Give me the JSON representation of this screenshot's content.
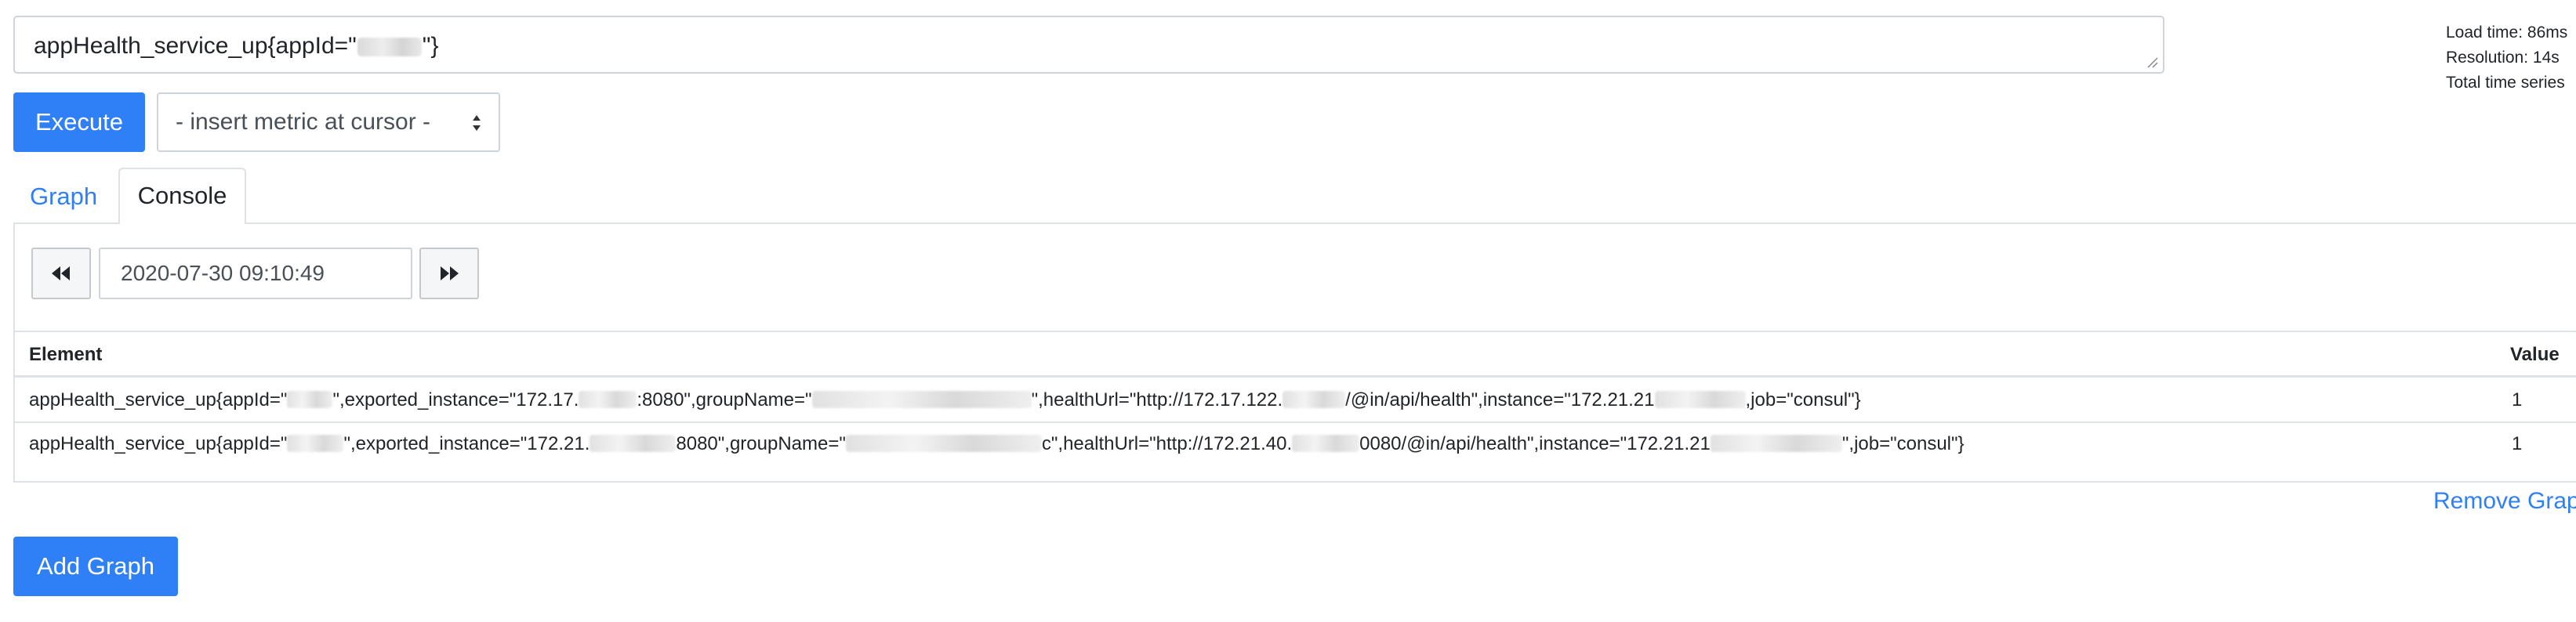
{
  "query": {
    "prefix": "appHealth_service_up{appId=\"",
    "suffix": "\"}"
  },
  "stats": {
    "load_time": "Load time: 86ms",
    "resolution": "Resolution: 14s",
    "total_series": "Total time series"
  },
  "toolbar": {
    "execute_label": "Execute",
    "metric_select_value": "- insert metric at cursor -"
  },
  "tabs": {
    "graph": "Graph",
    "console": "Console",
    "active": "Console"
  },
  "console": {
    "eval_time": "2020-07-30 09:10:49"
  },
  "table": {
    "headers": {
      "element": "Element",
      "value": "Value"
    },
    "rows": [
      {
        "parts": [
          "appHealth_service_up{appId=\"",
          "\",exported_instance=\"172.17.",
          ":8080\",groupName=\"",
          "\",healthUrl=\"http://172.17.122.",
          "/@in/api/health\",instance=\"172.21.21",
          ",job=\"consul\"}"
        ],
        "value": "1"
      },
      {
        "parts": [
          "appHealth_service_up{appId=\"",
          "\",exported_instance=\"172.21.",
          "8080\",groupName=\"",
          "c\",healthUrl=\"http://172.21.40.",
          "0080/@in/api/health\",instance=\"172.21.21",
          "\",job=\"consul\"}"
        ],
        "value": "1"
      }
    ]
  },
  "actions": {
    "remove_graph": "Remove Graph",
    "add_graph": "Add Graph"
  },
  "colors": {
    "primary": "#2f7ff6",
    "border": "#dee2e6"
  }
}
